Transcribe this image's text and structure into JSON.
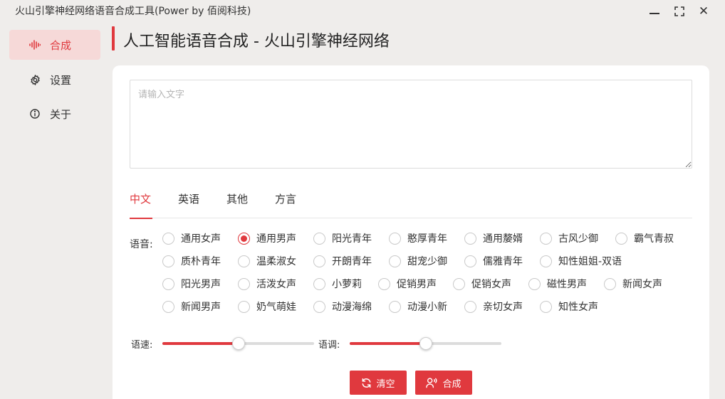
{
  "window": {
    "title": "火山引擎神经网络语音合成工具(Power by 佰阅科技)",
    "controls": [
      "minimize-icon",
      "maximize-icon",
      "close-icon"
    ],
    "close_glyph": "✕",
    "maximize_glyph": "⛶"
  },
  "sidebar": {
    "items": [
      {
        "label": "合成",
        "icon": "audio-wave-icon",
        "active": true
      },
      {
        "label": "设置",
        "icon": "gear-icon",
        "active": false
      },
      {
        "label": "关于",
        "icon": "info-icon",
        "active": false
      }
    ]
  },
  "page": {
    "title": "人工智能语音合成 - 火山引擎神经网络"
  },
  "input": {
    "value": "",
    "placeholder": "请输入文字"
  },
  "tabs": [
    {
      "label": "中文",
      "active": true
    },
    {
      "label": "英语",
      "active": false
    },
    {
      "label": "其他",
      "active": false
    },
    {
      "label": "方言",
      "active": false
    }
  ],
  "voices": {
    "label": "语音:",
    "selected": "通用男声",
    "rows": [
      [
        "通用女声",
        "通用男声",
        "阳光青年",
        "憨厚青年",
        "通用嫠婿",
        "古风少御",
        "霸气青叔"
      ],
      [
        "质朴青年",
        "温柔淑女",
        "开朗青年",
        "甜宠少御",
        "儒雅青年",
        "知性姐姐-双语"
      ],
      [
        "阳光男声",
        "活泼女声",
        "小萝莉",
        "促销男声",
        "促销女声",
        "磁性男声",
        "新闻女声"
      ],
      [
        "新闻男声",
        "奶气萌娃",
        "动漫海绵",
        "动漫小新",
        "亲切女声",
        "知性女声"
      ]
    ]
  },
  "sliders": {
    "speed": {
      "label": "语速:",
      "value": 0.5
    },
    "pitch": {
      "label": "语调:",
      "value": 0.5
    }
  },
  "buttons": {
    "clear": {
      "label": "清空",
      "icon": "refresh-icon"
    },
    "synth": {
      "label": "合成",
      "icon": "voice-person-icon"
    }
  },
  "colors": {
    "accent": "#e0393e",
    "active_nav_bg": "#f6d9d8",
    "background": "#efedeb"
  }
}
